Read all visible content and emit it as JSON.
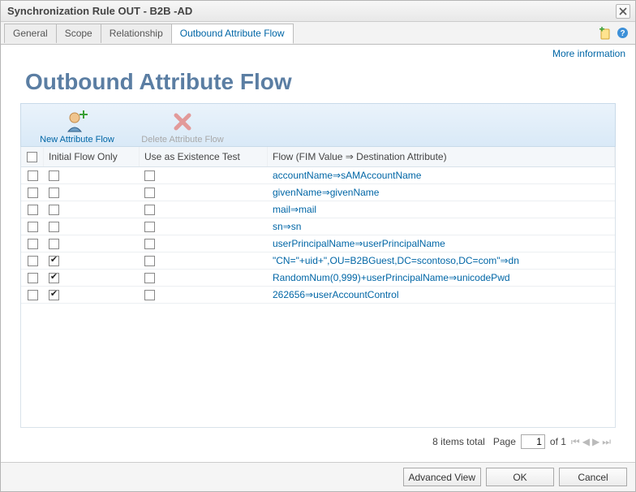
{
  "window": {
    "title": "Synchronization Rule OUT - B2B -AD"
  },
  "tabs": {
    "items": [
      {
        "label": "General"
      },
      {
        "label": "Scope"
      },
      {
        "label": "Relationship"
      },
      {
        "label": "Outbound Attribute Flow",
        "active": true
      }
    ]
  },
  "moreInfo": "More information",
  "page": {
    "heading": "Outbound Attribute Flow"
  },
  "toolbar": {
    "newFlow": "New Attribute Flow",
    "deleteFlow": "Delete Attribute Flow"
  },
  "grid": {
    "headers": {
      "initial": "Initial Flow Only",
      "existence": "Use as Existence Test",
      "flow": "Flow (FIM Value ⇒ Destination Attribute)"
    },
    "rows": [
      {
        "initial": false,
        "existence": false,
        "flow": "accountName⇒sAMAccountName"
      },
      {
        "initial": false,
        "existence": false,
        "flow": "givenName⇒givenName"
      },
      {
        "initial": false,
        "existence": false,
        "flow": "mail⇒mail"
      },
      {
        "initial": false,
        "existence": false,
        "flow": "sn⇒sn"
      },
      {
        "initial": false,
        "existence": false,
        "flow": "userPrincipalName⇒userPrincipalName"
      },
      {
        "initial": true,
        "existence": false,
        "flow": "\"CN=\"+uid+\",OU=B2BGuest,DC=scontoso,DC=com\"⇒dn"
      },
      {
        "initial": true,
        "existence": false,
        "flow": "RandomNum(0,999)+userPrincipalName⇒unicodePwd"
      },
      {
        "initial": true,
        "existence": false,
        "flow": "262656⇒userAccountControl"
      }
    ]
  },
  "pager": {
    "totalText": "8 items total",
    "pageLabel": "Page",
    "pageValue": "1",
    "ofLabel": "of 1"
  },
  "footer": {
    "advanced": "Advanced View",
    "ok": "OK",
    "cancel": "Cancel"
  }
}
